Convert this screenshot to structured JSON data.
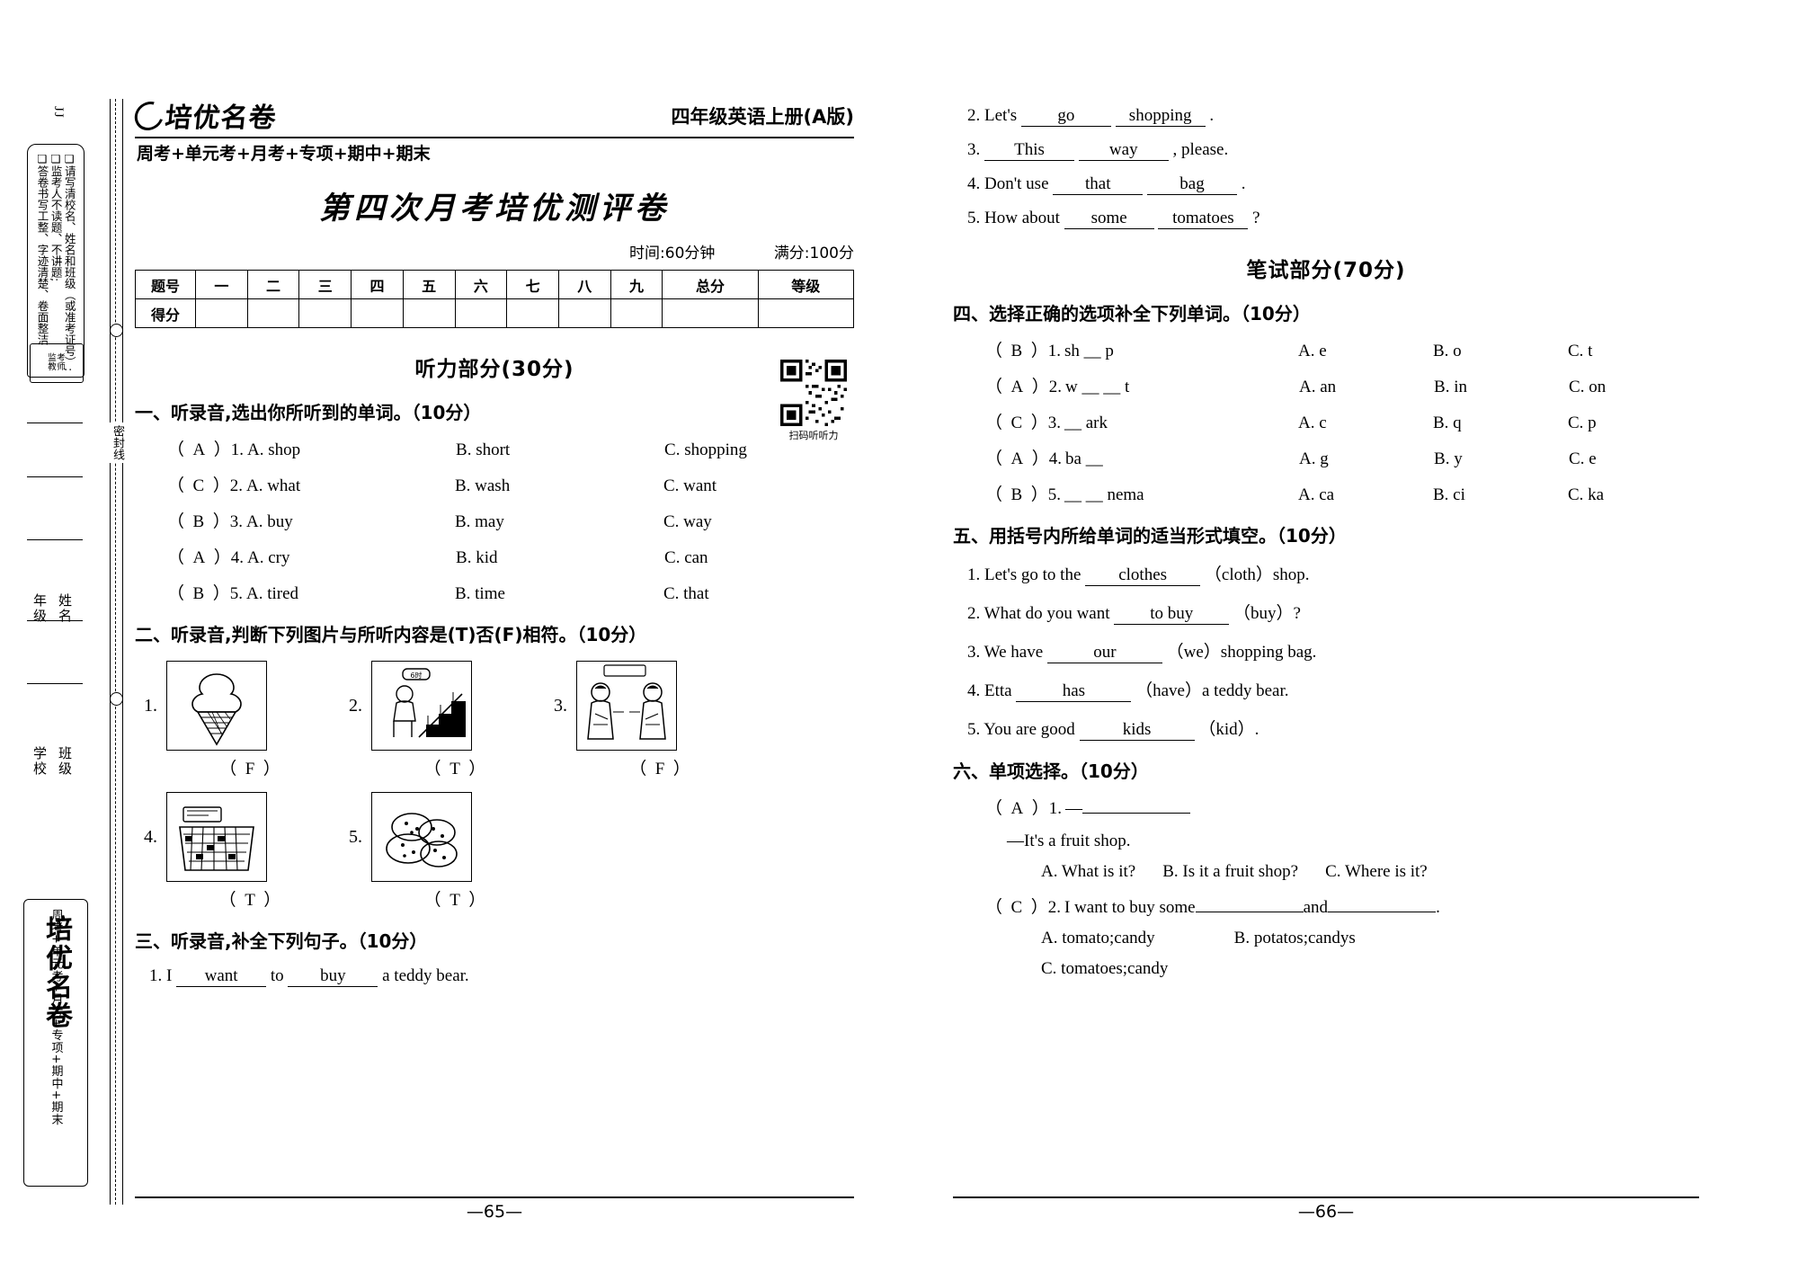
{
  "sidebar": {
    "jj": "JJ",
    "notice_lines": [
      "❏请写清校名、姓名和班级（或准考证号）;",
      "❏监考人不读题、不讲题;",
      "❏答卷书写工整、字迹清楚、卷面整洁"
    ],
    "seal_text": "监考教师签字",
    "fields": [
      "年级",
      "姓名",
      "学校",
      "班级"
    ],
    "fold_word": "密封线",
    "brand_vertical": "培优名卷",
    "brand_vertical_sub": "周考+单元考+月考+专项+期中+期末"
  },
  "header": {
    "brand": "培优名卷",
    "subtitle": "周考+单元考+月考+专项+期中+期末",
    "book": "四年级英语上册(A版)"
  },
  "paper": {
    "title": "第四次月考培优测评卷",
    "time": "时间:60分钟",
    "full_marks": "满分:100分"
  },
  "score_table": {
    "row_labels": [
      "题号",
      "得分"
    ],
    "columns": [
      "一",
      "二",
      "三",
      "四",
      "五",
      "六",
      "七",
      "八",
      "九",
      "总分",
      "等级"
    ]
  },
  "listening": {
    "part_title": "听力部分(30分)",
    "s1": {
      "title": "一、听录音,选出你所听到的单词。（10分）",
      "items": [
        {
          "ans": "A",
          "no": "1.",
          "a": "A. shop",
          "b": "B. short",
          "c": "C. shopping"
        },
        {
          "ans": "C",
          "no": "2.",
          "a": "A. what",
          "b": "B. wash",
          "c": "C. want"
        },
        {
          "ans": "B",
          "no": "3.",
          "a": "A. buy",
          "b": "B. may",
          "c": "C. way"
        },
        {
          "ans": "A",
          "no": "4.",
          "a": "A. cry",
          "b": "B. kid",
          "c": "C. can"
        },
        {
          "ans": "B",
          "no": "5.",
          "a": "A. tired",
          "b": "B. time",
          "c": "C. that"
        }
      ]
    },
    "s2": {
      "title": "二、听录音,判断下列图片与所听内容是(T)否(F)相符。（10分）",
      "items": [
        {
          "no": "1.",
          "icon": "ice-cream-cone",
          "ans": "F"
        },
        {
          "no": "2.",
          "icon": "person-at-desk",
          "ans": "T"
        },
        {
          "no": "3.",
          "icon": "two-people-talking",
          "ans": "F"
        },
        {
          "no": "4.",
          "icon": "cash-register",
          "ans": "T"
        },
        {
          "no": "5.",
          "icon": "cookies",
          "ans": "T"
        }
      ]
    },
    "s3": {
      "title": "三、听录音,补全下列句子。（10分）",
      "sentences": [
        {
          "no": "1.",
          "pre": "I",
          "b1": "want",
          "mid": "to",
          "b2": "buy",
          "post": "a teddy bear."
        },
        {
          "no": "2.",
          "pre": "Let's",
          "b1": "go",
          "mid": "",
          "b2": "shopping",
          "post": "."
        },
        {
          "no": "3.",
          "pre": "",
          "b1": "This",
          "mid": "",
          "b2": "way",
          "post": ", please."
        },
        {
          "no": "4.",
          "pre": "Don't use",
          "b1": "that",
          "mid": "",
          "b2": "bag",
          "post": "."
        },
        {
          "no": "5.",
          "pre": "How about",
          "b1": "some",
          "mid": "",
          "b2": "tomatoes",
          "post": "?"
        }
      ]
    },
    "qr_caption": "扫码听听力"
  },
  "written": {
    "part_title": "笔试部分(70分)",
    "s4": {
      "title": "四、选择正确的选项补全下列单词。（10分）",
      "items": [
        {
          "ans": "B",
          "no": "1.",
          "word": "sh __ p",
          "a": "A. e",
          "b": "B. o",
          "c": "C. t"
        },
        {
          "ans": "A",
          "no": "2.",
          "word": "w __ __ t",
          "a": "A. an",
          "b": "B. in",
          "c": "C. on"
        },
        {
          "ans": "C",
          "no": "3.",
          "word": "__ ark",
          "a": "A. c",
          "b": "B. q",
          "c": "C. p"
        },
        {
          "ans": "A",
          "no": "4.",
          "word": "ba __",
          "a": "A. g",
          "b": "B. y",
          "c": "C. e"
        },
        {
          "ans": "B",
          "no": "5.",
          "word": "__ __ nema",
          "a": "A. ca",
          "b": "B. ci",
          "c": "C. ka"
        }
      ]
    },
    "s5": {
      "title": "五、用括号内所给单词的适当形式填空。（10分）",
      "items": [
        {
          "no": "1.",
          "pre": "Let's go to the",
          "ans": "clothes",
          "post": "（cloth）shop."
        },
        {
          "no": "2.",
          "pre": "What do you want",
          "ans": "to buy",
          "post": "（buy）?"
        },
        {
          "no": "3.",
          "pre": "We have",
          "ans": "our",
          "post": "（we）shopping bag."
        },
        {
          "no": "4.",
          "pre": "Etta",
          "ans": "has",
          "post": "（have）a teddy bear."
        },
        {
          "no": "5.",
          "pre": "You are good",
          "ans": "kids",
          "post": "（kid）."
        }
      ]
    },
    "s6": {
      "title": "六、单项选择。（10分）",
      "items": [
        {
          "ans": "A",
          "no": "1.",
          "stem": "—",
          "reply": "—It's a fruit shop.",
          "a": "A. What is it?",
          "b": "B. Is it a fruit shop?",
          "c": "C. Where is it?"
        },
        {
          "ans": "C",
          "no": "2.",
          "stem": "I want to buy some",
          "stem2": "and",
          "stem3": ".",
          "a": "A. tomato;candy",
          "b": "B. potatos;candys",
          "c": "C. tomatoes;candy"
        }
      ]
    }
  },
  "pages": {
    "left": "—65—",
    "right": "—66—"
  }
}
